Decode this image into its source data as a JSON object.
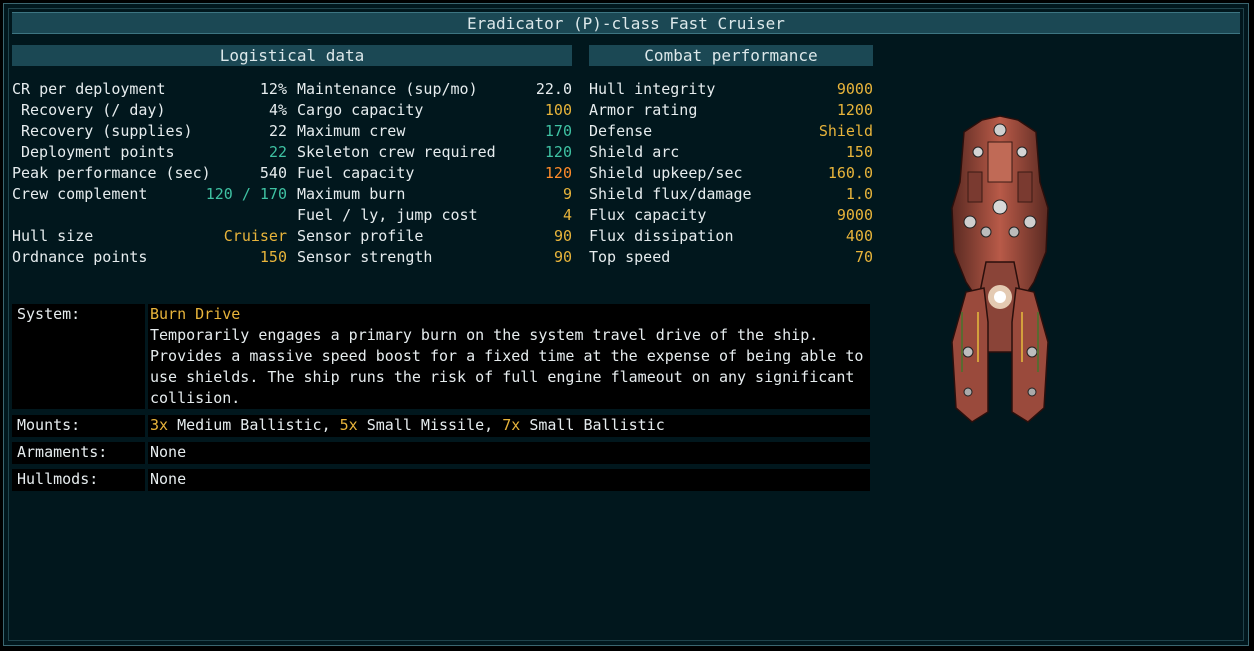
{
  "window": {
    "title": "Eradicator (P)-class Fast Cruiser"
  },
  "logistical": {
    "header": "Logistical data",
    "col1": [
      {
        "label": "CR per deployment",
        "value": "12%",
        "color": "white",
        "indent": false
      },
      {
        "label": "Recovery (/ day)",
        "value": "4%",
        "color": "white",
        "indent": true
      },
      {
        "label": "Recovery (supplies)",
        "value": "22",
        "color": "white",
        "indent": true
      },
      {
        "label": "Deployment points",
        "value": "22",
        "color": "teal",
        "indent": true
      },
      {
        "label": "Peak performance (sec)",
        "value": "540",
        "color": "white",
        "indent": false
      },
      {
        "label": "Crew complement",
        "value": "120 / 170",
        "color": "teal",
        "indent": false
      },
      {
        "label": "",
        "value": "",
        "color": "white",
        "indent": false
      },
      {
        "label": "Hull size",
        "value": "Cruiser",
        "color": "yellow",
        "indent": false
      },
      {
        "label": "Ordnance points",
        "value": "150",
        "color": "yellow",
        "indent": false
      }
    ],
    "col2": [
      {
        "label": "Maintenance (sup/mo)",
        "value": "22.0",
        "color": "white"
      },
      {
        "label": "Cargo capacity",
        "value": "100",
        "color": "yellow"
      },
      {
        "label": "Maximum crew",
        "value": "170",
        "color": "teal"
      },
      {
        "label": "Skeleton crew required",
        "value": "120",
        "color": "teal"
      },
      {
        "label": "Fuel capacity",
        "value": "120",
        "color": "orange"
      },
      {
        "label": "Maximum burn",
        "value": "9",
        "color": "yellow"
      },
      {
        "label": "Fuel / ly, jump cost",
        "value": "4",
        "color": "yellow"
      },
      {
        "label": "Sensor profile",
        "value": "90",
        "color": "yellow"
      },
      {
        "label": "Sensor strength",
        "value": "90",
        "color": "yellow"
      }
    ]
  },
  "combat": {
    "header": "Combat performance",
    "rows": [
      {
        "label": "Hull integrity",
        "value": "9000",
        "color": "yellow"
      },
      {
        "label": "Armor rating",
        "value": "1200",
        "color": "yellow"
      },
      {
        "label": "Defense",
        "value": "Shield",
        "color": "yellow"
      },
      {
        "label": "Shield arc",
        "value": "150",
        "color": "yellow"
      },
      {
        "label": "Shield upkeep/sec",
        "value": "160.0",
        "color": "yellow"
      },
      {
        "label": "Shield flux/damage",
        "value": "1.0",
        "color": "yellow"
      },
      {
        "label": "Flux capacity",
        "value": "9000",
        "color": "yellow"
      },
      {
        "label": "Flux dissipation",
        "value": "400",
        "color": "yellow"
      },
      {
        "label": "Top speed",
        "value": "70",
        "color": "yellow"
      }
    ]
  },
  "details": {
    "system": {
      "label": "System:",
      "name": "Burn Drive",
      "description": "Temporarily engages a primary burn on the system travel drive of the ship. Provides a massive speed boost for a fixed time at the expense of being able to use shields. The ship runs the risk of full engine flameout on any significant collision."
    },
    "mounts": {
      "label": "Mounts:",
      "items": [
        {
          "count": "3x",
          "name": "Medium Ballistic"
        },
        {
          "count": "5x",
          "name": "Small Missile"
        },
        {
          "count": "7x",
          "name": "Small Ballistic"
        }
      ]
    },
    "armaments": {
      "label": "Armaments:",
      "value": "None"
    },
    "hullmods": {
      "label": "Hullmods:",
      "value": "None"
    }
  },
  "colors": {
    "white": "#e6ecee",
    "yellow": "#e8b43b",
    "teal": "#3fc2a3",
    "orange": "#ff8b2a",
    "header_bg": "#1b4854",
    "panel_bg": "#01171d"
  },
  "ship_image": {
    "icon": "eradicator-ship-sprite"
  }
}
